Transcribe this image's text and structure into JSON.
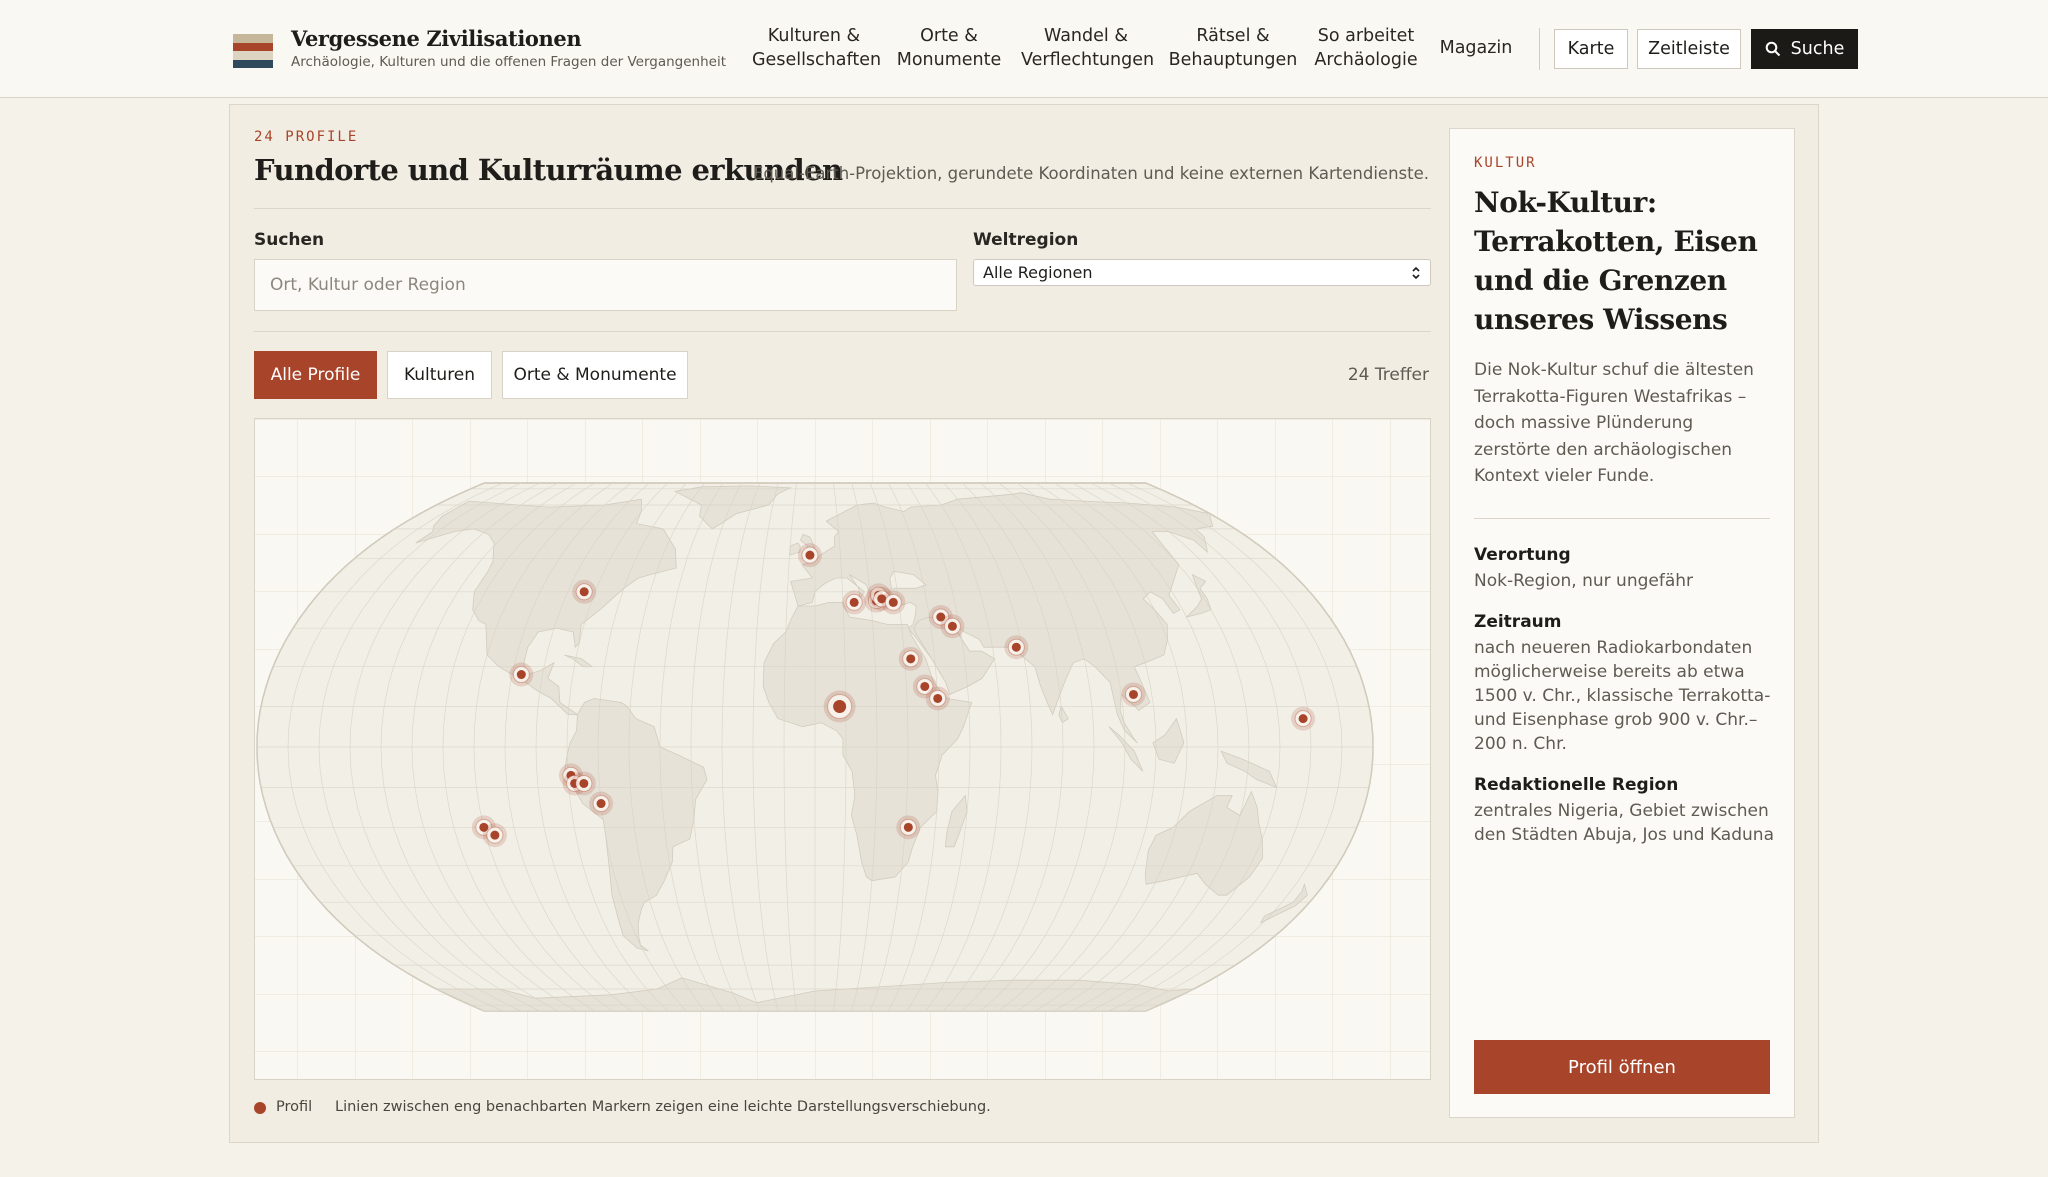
{
  "header": {
    "brand_title": "Vergessene Zivilisationen",
    "brand_subtitle": "Archäologie, Kulturen und die offenen Fragen der Vergangenheit",
    "nav": [
      {
        "label": "Kulturen &\nGesellschaften"
      },
      {
        "label": "Orte &\nMonumente"
      },
      {
        "label": "Wandel &\nVerflechtungen"
      },
      {
        "label": "Rätsel &\nBehauptungen"
      },
      {
        "label": "So arbeitet\nArchäologie"
      },
      {
        "label": "Magazin"
      }
    ],
    "buttons": {
      "map": "Karte",
      "timeline": "Zeitleiste",
      "search": "Suche"
    }
  },
  "explorer": {
    "kicker": "24 PROFILE",
    "title": "Fundorte und Kulturräume erkunden",
    "projection_note": "Equal-Earth-Projektion, gerundete Koordinaten und keine externen Kartendienste.",
    "search_label": "Suchen",
    "search_placeholder": "Ort, Kultur oder Region",
    "region_label": "Weltregion",
    "region_selected": "Alle Regionen",
    "tabs": [
      {
        "label": "Alle Profile",
        "active": true
      },
      {
        "label": "Kulturen",
        "active": false
      },
      {
        "label": "Orte & Monumente",
        "active": false
      }
    ],
    "hits": "24 Treffer",
    "legend_label": "Profil",
    "legend_note": "Linien zwischen eng benachbarten Markern zeigen eine leichte Darstellungsverschiebung."
  },
  "map": {
    "colors": {
      "land": "#e6e2d7",
      "ocean": "#f2efe6",
      "marker": "#a8442a",
      "graticule": "#d8d2c5"
    },
    "markers": [
      {
        "lat": 51,
        "lon": -2
      },
      {
        "lat": 40,
        "lon": -84
      },
      {
        "lat": 18,
        "lon": -97
      },
      {
        "lat": 37,
        "lon": 14
      },
      {
        "lat": 37.5,
        "lon": 22
      },
      {
        "lat": 39,
        "lon": 23
      },
      {
        "lat": 38,
        "lon": 24
      },
      {
        "lat": 37,
        "lon": 28
      },
      {
        "lat": 33,
        "lon": 44
      },
      {
        "lat": 30.5,
        "lon": 47.5
      },
      {
        "lat": 25,
        "lon": 68
      },
      {
        "lat": 22,
        "lon": 32
      },
      {
        "lat": 15,
        "lon": 36
      },
      {
        "lat": 12,
        "lon": 40
      },
      {
        "lat": 10,
        "lon": 8,
        "selected": true
      },
      {
        "lat": 13,
        "lon": 104
      },
      {
        "lat": 7,
        "lon": 158
      },
      {
        "lat": -7,
        "lon": -79
      },
      {
        "lat": -9,
        "lon": -78
      },
      {
        "lat": -9,
        "lon": -75
      },
      {
        "lat": -14,
        "lon": -70
      },
      {
        "lat": -20,
        "lon": 31
      },
      {
        "lat": -20,
        "lon": -110
      },
      {
        "lat": -22,
        "lon": -107
      }
    ]
  },
  "profile": {
    "kicker": "KULTUR",
    "title": "Nok-Kultur: Terrakotten, Eisen und die Grenzen unseres Wissens",
    "description": "Die Nok-Kultur schuf die ältesten Terrakotta-Figuren Westafrikas – doch massive Plünderung zerstörte den archäologischen Kontext vieler Funde.",
    "facts": [
      {
        "label": "Verortung",
        "value": "Nok-Region, nur ungefähr"
      },
      {
        "label": "Zeitraum",
        "value": "nach neueren Radiokarbondaten möglicherweise bereits ab etwa 1500 v. Chr., klassische Terrakotta- und Eisenphase grob 900 v. Chr.–200 n. Chr."
      },
      {
        "label": "Redaktionelle Region",
        "value": "zentrales Nigeria, Gebiet zwischen den Städten Abuja, Jos und Kaduna"
      }
    ],
    "button": "Profil öffnen"
  }
}
